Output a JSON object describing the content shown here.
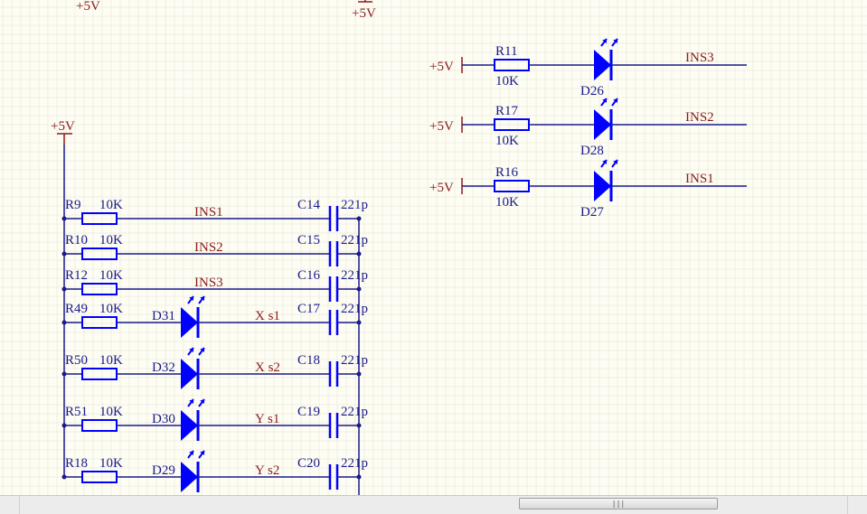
{
  "power": {
    "symbol": "+5V"
  },
  "left_block": {
    "rows": [
      {
        "res": "R9",
        "res_val": "10K",
        "net": "INS1",
        "cap": "C14",
        "cap_val": "221p",
        "led": null
      },
      {
        "res": "R10",
        "res_val": "10K",
        "net": "INS2",
        "cap": "C15",
        "cap_val": "221p",
        "led": null
      },
      {
        "res": "R12",
        "res_val": "10K",
        "net": "INS3",
        "cap": "C16",
        "cap_val": "221p",
        "led": null
      },
      {
        "res": "R49",
        "res_val": "10K",
        "net": "X  s1",
        "cap": "C17",
        "cap_val": "221p",
        "led": "D31"
      },
      {
        "res": "R50",
        "res_val": "10K",
        "net": "X  s2",
        "cap": "C18",
        "cap_val": "221p",
        "led": "D32"
      },
      {
        "res": "R51",
        "res_val": "10K",
        "net": "Y  s1",
        "cap": "C19",
        "cap_val": "221p",
        "led": "D30"
      },
      {
        "res": "R18",
        "res_val": "10K",
        "net": "Y  s2",
        "cap": "C20",
        "cap_val": "221p",
        "led": "D29"
      }
    ]
  },
  "right_block": {
    "rows": [
      {
        "res": "R11",
        "res_val": "10K",
        "led": "D26",
        "net": "INS3"
      },
      {
        "res": "R17",
        "res_val": "10K",
        "led": "D28",
        "net": "INS2"
      },
      {
        "res": "R16",
        "res_val": "10K",
        "led": "D27",
        "net": "INS1"
      }
    ]
  },
  "colors": {
    "wire": "#1a1a8c",
    "component": "#0000ff",
    "net_label": "#8b1a1a",
    "power": "#8b1a1a",
    "grid": "#e4e4d4",
    "background": "#fdfdf4"
  },
  "scrollbar": {
    "thumb_grip": "|||"
  }
}
